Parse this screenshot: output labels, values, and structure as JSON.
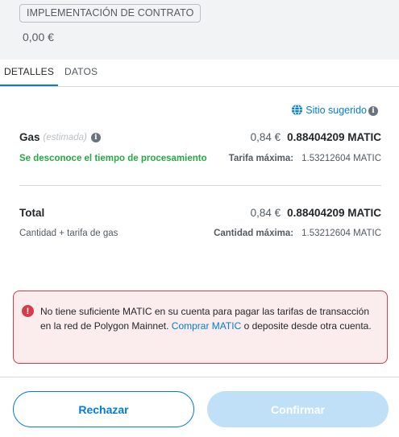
{
  "header": {
    "contract_badge": "IMPLEMENTACIÓN DE CONTRATO",
    "amount": "0,00 €"
  },
  "tabs": [
    {
      "label": "DETALLES",
      "active": true
    },
    {
      "label": "DATOS",
      "active": false
    }
  ],
  "suggested_site": {
    "label": "Sitio sugerido",
    "chevron": ">",
    "icon": "globe-icon"
  },
  "gas": {
    "label": "Gas",
    "estimated": "(estimada)",
    "fiat": "0,84 €",
    "crypto": "0.88404209 MATIC",
    "processing_time": "Se desconoce el tiempo de procesamiento",
    "max_fee_label": "Tarifa máxima:",
    "max_fee_value": "1.53212604 MATIC"
  },
  "total": {
    "label": "Total",
    "fiat": "0,84 €",
    "crypto": "0.88404209 MATIC",
    "sub_label": "Cantidad + tarifa de gas",
    "max_amount_label": "Cantidad máxima:",
    "max_amount_value": "1.53212604 MATIC"
  },
  "alert": {
    "icon": "error-icon",
    "text_before": "No tiene suficiente MATIC en su cuenta para pagar las tarifas de transacción en la red de Polygon Mainnet. ",
    "link": "Comprar MATIC",
    "text_after": " o deposite desde otra cuenta."
  },
  "footer": {
    "reject_label": "Rechazar",
    "confirm_label": "Confirmar"
  },
  "colors": {
    "primary": "#037dd6",
    "success": "#28a745",
    "error": "#d73a49",
    "error_bg": "#fbeced",
    "confirm_disabled": "#bfe0f7"
  }
}
